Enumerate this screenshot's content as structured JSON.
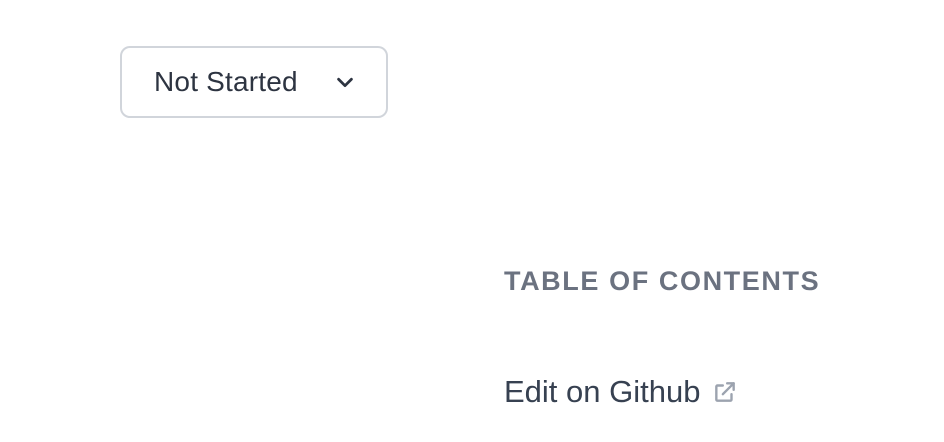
{
  "status_select": {
    "value": "Not Started",
    "icon": "chevron-down-icon"
  },
  "toc": {
    "heading": "TABLE OF CONTENTS"
  },
  "edit_link": {
    "label": "Edit on Github",
    "icon": "external-link-icon"
  },
  "colors": {
    "text_dark": "#2d3441",
    "heading_gray": "#6b7280",
    "border": "#d1d5db",
    "icon_gray": "#9ca3af"
  }
}
